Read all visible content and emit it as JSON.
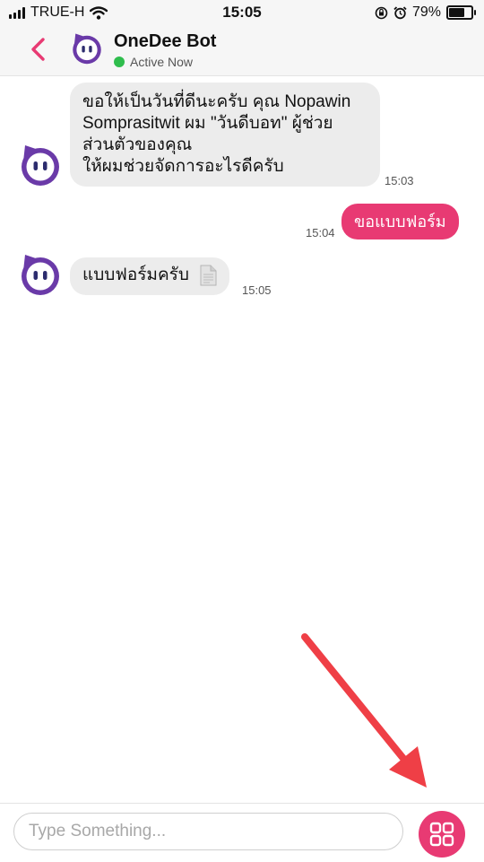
{
  "status_bar": {
    "carrier": "TRUE-H",
    "time": "15:05",
    "battery_percent": "79%",
    "battery_level": 0.79
  },
  "header": {
    "back_icon": "chevron-left-icon",
    "title": "OneDee Bot",
    "status": "Active Now",
    "status_color": "#2fbd4d"
  },
  "messages": [
    {
      "sender": "bot",
      "lines": [
        "ขอให้เป็นวันที่ดีนะครับ คุณ Nopawin",
        "Somprasitwit ผม \"วันดีบอท\" ผู้ช่วย",
        "ส่วนตัวของคุณ",
        "ให้ผมช่วยจัดการอะไรดีครับ"
      ],
      "time": "15:03"
    },
    {
      "sender": "user",
      "text": "ขอแบบฟอร์ม",
      "time": "15:04"
    },
    {
      "sender": "bot",
      "text": "แบบฟอร์มครับ",
      "icon": "document-icon",
      "time": "15:05"
    }
  ],
  "composer": {
    "placeholder": "Type Something...",
    "menu_icon": "grid-menu-icon"
  },
  "colors": {
    "accent": "#e83a73",
    "bot_bubble": "#ececec",
    "avatar_purple": "#6a3aa8"
  }
}
